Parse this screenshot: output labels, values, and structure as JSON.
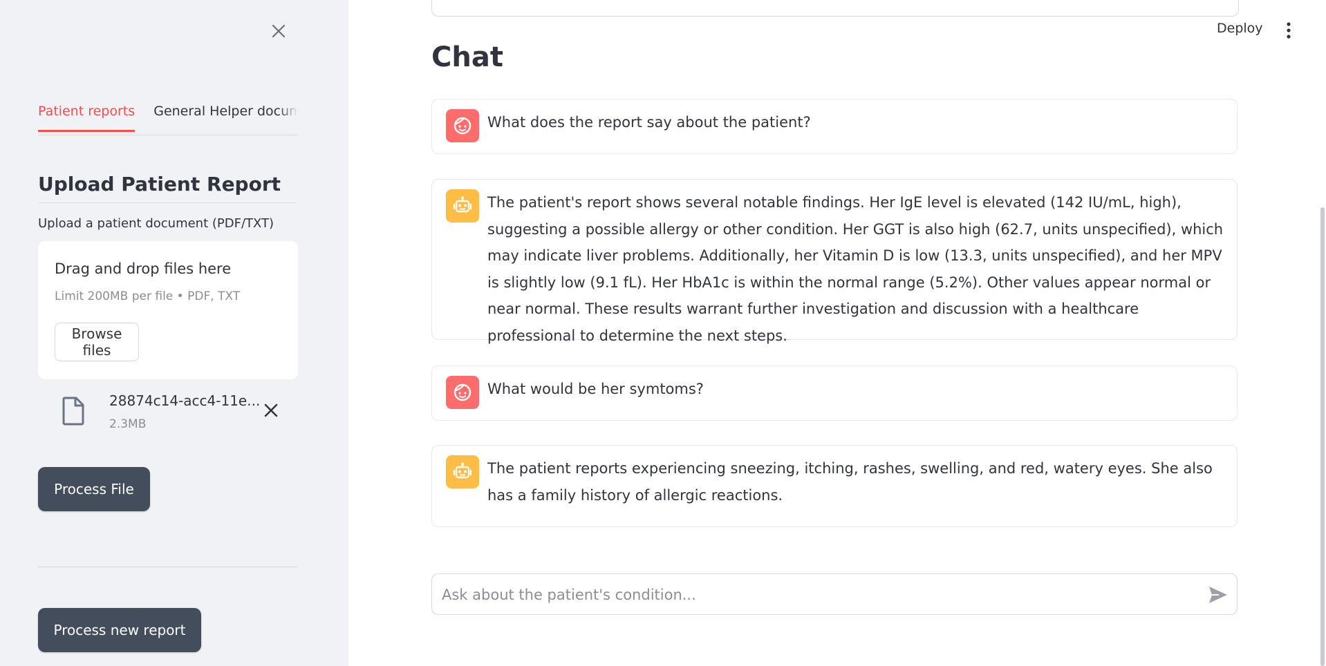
{
  "sidebar": {
    "tabs": [
      {
        "label": "Patient reports",
        "active": true
      },
      {
        "label": "General Helper documen",
        "active": false
      }
    ],
    "upload_heading": "Upload Patient Report",
    "upload_caption": "Upload a patient document (PDF/TXT)",
    "dropzone": {
      "title": "Drag and drop files here",
      "limit": "Limit 200MB per file • PDF, TXT",
      "browse_label": "Browse files"
    },
    "file": {
      "name": "28874c14-acc4-11e...",
      "size": "2.3MB"
    },
    "process_file_label": "Process File",
    "process_new_label": "Process new report"
  },
  "header": {
    "deploy_label": "Deploy"
  },
  "chat": {
    "heading": "Chat",
    "messages": [
      {
        "role": "user",
        "text": "What does the report say about the patient?"
      },
      {
        "role": "assistant",
        "text": "The patient's report shows several notable findings. Her IgE level is elevated (142 IU/mL, high), suggesting a possible allergy or other condition. Her GGT is also high (62.7, units unspecified), which may indicate liver problems. Additionally, her Vitamin D is low (13.3, units unspecified), and her MPV is slightly low (9.1 fL). Her HbA1c is within the normal range (5.2%). Other values appear normal or near normal. These results warrant further investigation and discussion with a healthcare professional to determine the next steps."
      },
      {
        "role": "user",
        "text": "What would be her symtoms?"
      },
      {
        "role": "assistant",
        "text": "The patient reports experiencing sneezing, itching, rashes, swelling, and red, watery eyes. She also has a family history of allergic reactions."
      }
    ],
    "input_placeholder": "Ask about the patient's condition..."
  },
  "colors": {
    "accent": "#ff4b4b",
    "sidebar_bg": "#f0f2f6",
    "dark_button": "#434d5c",
    "user_avatar": "#ff6c6c",
    "bot_avatar": "#ffbd45"
  },
  "icons": {
    "close": "close-icon",
    "file": "file-icon",
    "remove": "remove-file-icon",
    "menu": "more-vertical-icon",
    "user_avatar": "user-face-icon",
    "bot_avatar": "robot-icon",
    "send": "send-icon"
  }
}
